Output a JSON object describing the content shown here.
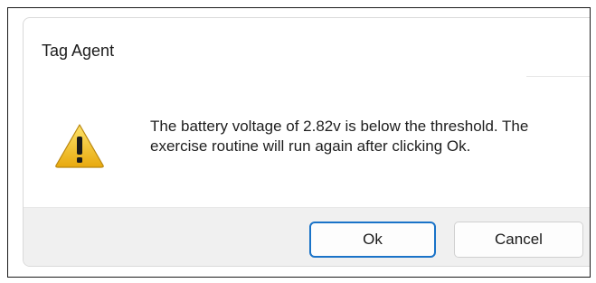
{
  "window": {
    "title": "Tag Agent"
  },
  "dialog": {
    "icon": "warning-icon",
    "message": "The battery voltage of 2.82v is below the threshold. The exercise routine will run again after clicking Ok."
  },
  "buttons": {
    "ok_label": "Ok",
    "cancel_label": "Cancel"
  },
  "colors": {
    "accent": "#1a73c8",
    "warning_fill": "#f2c21c",
    "footer_bg": "#f0f0f0"
  }
}
